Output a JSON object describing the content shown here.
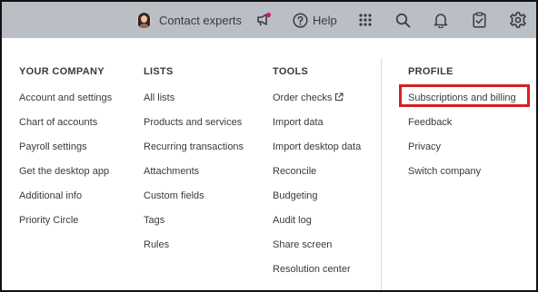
{
  "topbar": {
    "contact_label": "Contact experts",
    "help_label": "Help",
    "icons": [
      "avatar",
      "feedback-megaphone-icon",
      "help-icon",
      "apps-grid-icon",
      "search-icon",
      "bell-icon",
      "clipboard-check-icon",
      "gear-icon"
    ],
    "background": "#babec5"
  },
  "menu": {
    "columns": [
      {
        "heading": "YOUR COMPANY",
        "items": [
          "Account and settings",
          "Chart of accounts",
          "Payroll settings",
          "Get the desktop app",
          "Additional info",
          "Priority Circle"
        ]
      },
      {
        "heading": "LISTS",
        "items": [
          "All lists",
          "Products and services",
          "Recurring transactions",
          "Attachments",
          "Custom fields",
          "Tags",
          "Rules"
        ]
      },
      {
        "heading": "TOOLS",
        "items": [
          "Order checks",
          "Import data",
          "Import desktop data",
          "Reconcile",
          "Budgeting",
          "Audit log",
          "Share screen",
          "Resolution center"
        ]
      },
      {
        "heading": "PROFILE",
        "items": [
          "Subscriptions and billing",
          "Feedback",
          "Privacy",
          "Switch company"
        ]
      }
    ],
    "highlighted_item": "Subscriptions and billing",
    "highlight_color": "#d32027"
  }
}
